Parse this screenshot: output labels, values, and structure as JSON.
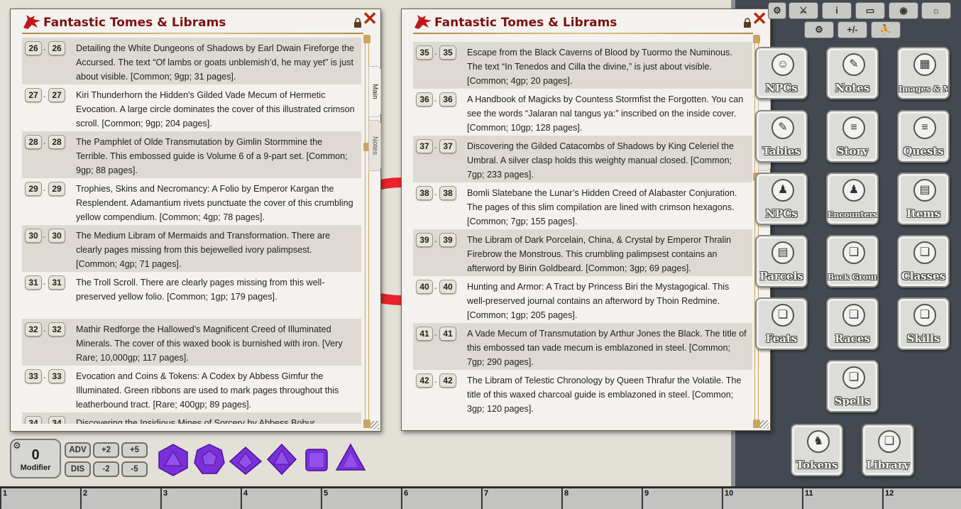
{
  "window_title": "Fantastic Tomes & Librams",
  "tabs": {
    "main": "Main",
    "notes": "Notes"
  },
  "left_window": {
    "rows": [
      {
        "from": "26",
        "to": "26",
        "text": "Detailing the White Dungeons of Shadows by Earl Dwain Fireforge the Accursed. The text “Of lambs or goats unblemish’d, he may yet” is just about visible. [Common; 9gp; 31 pages]."
      },
      {
        "from": "27",
        "to": "27",
        "text": "Kiri Thunderhorn the Hidden’s Gilded Vade Mecum of Hermetic Evocation. A large circle dominates the cover of this illustrated crimson scroll. [Common; 9gp; 204 pages]."
      },
      {
        "from": "28",
        "to": "28",
        "text": "The Pamphlet of Olde Transmutation by Gimlin Stormmine the Terrible. This embossed guide is Volume 6 of a 9-part set. [Common; 9gp; 88 pages]."
      },
      {
        "from": "29",
        "to": "29",
        "text": "Trophies, Skins and Necromancy: A Folio by Emperor Kargan the Resplendent. Adamantium rivets punctuate the cover of this crumbling yellow compendium. [Common; 4gp; 78 pages]."
      },
      {
        "from": "30",
        "to": "30",
        "text": "The Medium Libram of Mermaids and Transformation. There are clearly pages missing from this bejewelled ivory palimpsest. [Common; 4gp; 71 pages]."
      },
      {
        "from": "31",
        "to": "31",
        "text": "The Troll Scroll. There are clearly pages missing from this well-preserved yellow folio. [Common; 1gp; 179 pages]."
      },
      {
        "from": "32",
        "to": "32",
        "text": "Mathir Redforge the Hallowed’s Magnificent Creed of Illuminated Minerals. The cover of this waxed book is burnished with iron. [Very Rare; 10,000gp; 117 pages]."
      },
      {
        "from": "33",
        "to": "33",
        "text": "Evocation and Coins & Tokens: A Codex by Abbess Gimfur the Illuminated. Green ribbons are used to mark pages throughout this leatherbound tract. [Rare; 400gp; 89 pages]."
      },
      {
        "from": "34",
        "to": "34",
        "text": "Discovering the Insidious Mines of Sorcery by Abbess Bobur Stonequarry the Solar. This slim compendium contains a foreword"
      }
    ]
  },
  "right_window": {
    "rows": [
      {
        "from": "35",
        "to": "35",
        "text": "Escape from the Black Caverns of Blood by Tuormo the Numinous. The text “In Tenedos and Cilla the divine,” is just about visible. [Common; 4gp; 20 pages]."
      },
      {
        "from": "36",
        "to": "36",
        "text": "A Handbook of Magicks by Countess Stormfist the Forgotten. You can see the words “Jalaran nal tangus ya:” inscribed on the inside cover. [Common; 10gp; 128 pages]."
      },
      {
        "from": "37",
        "to": "37",
        "text": "Discovering the Gilded Catacombs of Shadows by King Celeriel the Umbral. A silver clasp holds this weighty manual closed. [Common; 7gp; 233 pages]."
      },
      {
        "from": "38",
        "to": "38",
        "text": "Bomli Slatebane the Lunar’s Hidden Creed of Alabaster Conjuration. The pages of this slim compilation are lined with crimson hexagons. [Common; 7gp; 155 pages]."
      },
      {
        "from": "39",
        "to": "39",
        "text": "The Libram of Dark Porcelain, China, & Crystal by Emperor Thralin Firebrow the Monstrous. This crumbling palimpsest contains an afterword by Birin Goldbeard. [Common; 3gp; 69 pages]."
      },
      {
        "from": "40",
        "to": "40",
        "text": "Hunting and Armor: A Tract by Princess Biri the Mystagogical. This well-preserved journal contains an afterword by Thoin Redmine. [Common; 1gp; 205 pages]."
      },
      {
        "from": "41",
        "to": "41",
        "text": "A Vade Mecum of Transmutation by Arthur Jones the Black. The title of this embossed tan vade mecum is emblazoned in steel. [Common; 7gp; 290 pages]."
      },
      {
        "from": "42",
        "to": "42",
        "text": "The Libram of Telestic Chronology by Queen Thrafur the Volatile. The title of this waxed charcoal guide is emblazoned in steel. [Common; 3gp; 120 pages]."
      }
    ]
  },
  "toolbar": {
    "plus_minus": "+/-"
  },
  "launchers": [
    {
      "key": "npcs-top",
      "label": "NPCs",
      "icon": "masks-icon"
    },
    {
      "key": "notes",
      "label": "Notes",
      "icon": "quill-icon"
    },
    {
      "key": "images-maps",
      "label": "Images & Maps",
      "icon": "map-icon"
    },
    {
      "key": "tables",
      "label": "Tables",
      "icon": "quill-icon"
    },
    {
      "key": "story",
      "label": "Story",
      "icon": "scroll-icon"
    },
    {
      "key": "quests",
      "label": "Quests",
      "icon": "scroll-icon"
    },
    {
      "key": "npcs",
      "label": "NPCs",
      "icon": "group-icon"
    },
    {
      "key": "encounters",
      "label": "Encounters",
      "icon": "group-icon"
    },
    {
      "key": "items",
      "label": "Items",
      "icon": "chest-icon"
    },
    {
      "key": "parcels",
      "label": "Parcels",
      "icon": "chest-icon"
    },
    {
      "key": "backgrounds",
      "label": "Back Grounds",
      "icon": "book-icon"
    },
    {
      "key": "classes",
      "label": "Classes",
      "icon": "book-icon"
    },
    {
      "key": "feats",
      "label": "Feats",
      "icon": "book-icon"
    },
    {
      "key": "races",
      "label": "Races",
      "icon": "book-icon"
    },
    {
      "key": "skills",
      "label": "Skills",
      "icon": "book-icon"
    },
    {
      "key": "spells",
      "label": "Spells",
      "icon": "book-icon"
    },
    {
      "key": "tokens",
      "label": "Tokens",
      "icon": "people-icon"
    },
    {
      "key": "library",
      "label": "Library",
      "icon": "book-icon"
    }
  ],
  "dice_tray": {
    "modifier_value": "0",
    "modifier_label": "Modifier",
    "buttons": {
      "adv": "ADV",
      "dis": "DIS",
      "p2": "+2",
      "p5": "+5",
      "m2": "-2",
      "m5": "-5"
    },
    "dice": [
      "d20",
      "d12",
      "d10",
      "d8",
      "d6",
      "d4"
    ],
    "dice_color": "#7a2fd8"
  },
  "hotbar": {
    "slots": [
      "1",
      "2",
      "3",
      "4",
      "5",
      "6",
      "7",
      "8",
      "9",
      "10",
      "11",
      "12"
    ]
  },
  "colors": {
    "title": "#7a1212",
    "close": "#b02c10",
    "accent_gold": "#c9a55e",
    "slate": "#434851"
  }
}
